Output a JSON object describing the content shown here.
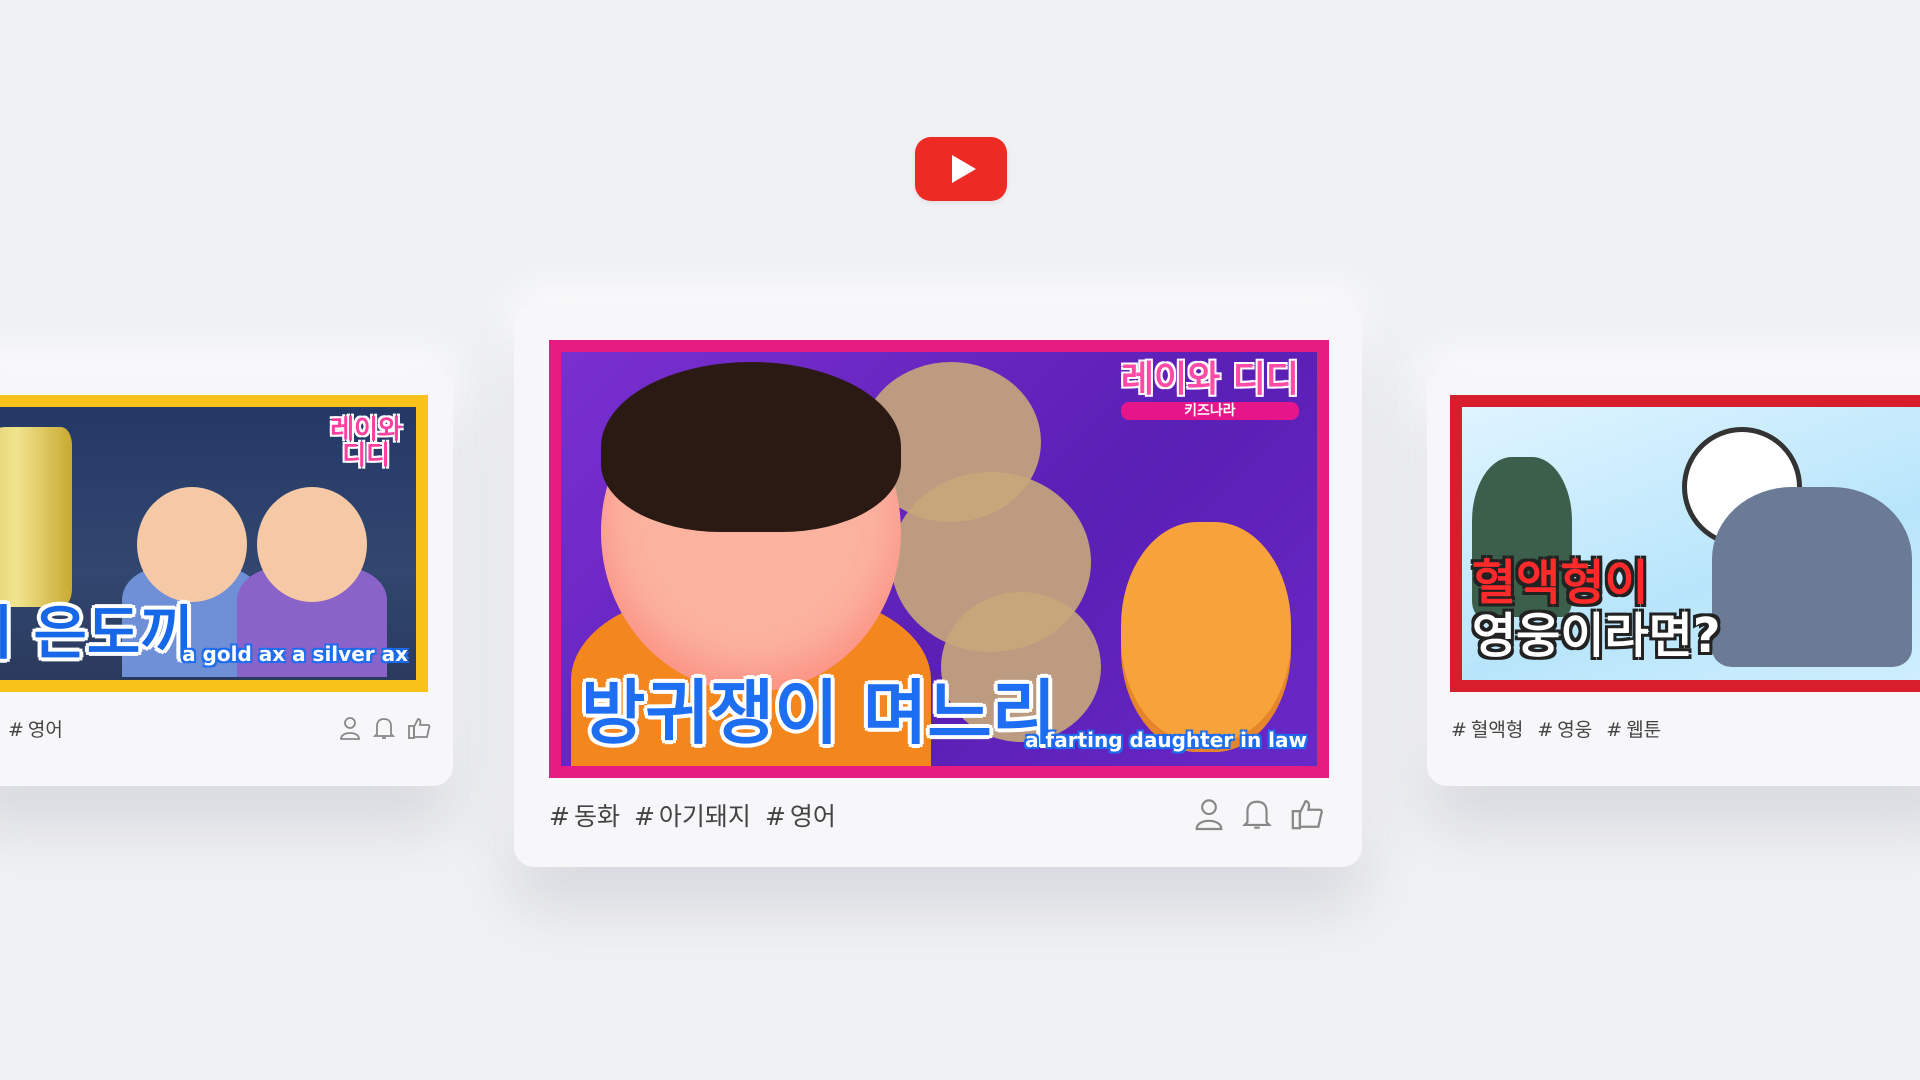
{
  "logo": {
    "name": "youtube-logo",
    "color": "#ee2a24"
  },
  "cards": {
    "left": {
      "title": "이 은도끼",
      "subtitle": "a gold ax a silver ax",
      "brand_line1": "레이와",
      "brand_line2": "디디",
      "tags": [
        "영어"
      ],
      "icons": [
        "user-icon",
        "bell-icon",
        "thumbs-up-icon"
      ],
      "frame_color": "#f8c21b"
    },
    "center": {
      "title": "방귀쟁이 며느리",
      "subtitle": "a farting daughter in law",
      "brand_line1": "레이와 디디",
      "brand_line2": "키즈나라",
      "tags": [
        "동화",
        "아기돼지",
        "영어"
      ],
      "icons": [
        "user-icon",
        "bell-icon",
        "thumbs-up-icon"
      ],
      "frame_color": "#e61c82"
    },
    "right": {
      "title_line1": "혈액형이",
      "title_line2": "영웅이라면?",
      "tags": [
        "혈액형",
        "영웅",
        "웹툰"
      ],
      "frame_color": "#d81d2c"
    }
  },
  "hash_symbol": "#"
}
